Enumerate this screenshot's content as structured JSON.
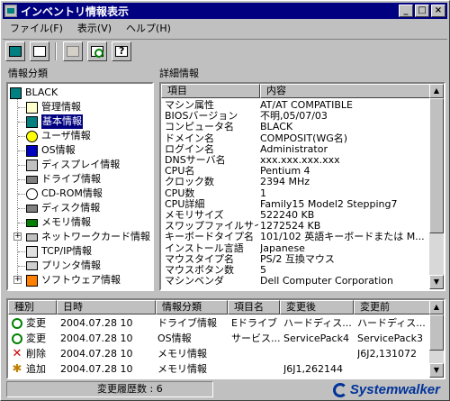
{
  "window": {
    "title": "インベントリ情報表示",
    "min_label": "_",
    "max_label": "□",
    "close_label": "×"
  },
  "menu": [
    "ファイル(F)",
    "表示(V)",
    "ヘルプ(H)"
  ],
  "left_label": "情報分類",
  "right_label": "詳細情報",
  "tree": {
    "root": "BLACK",
    "items": [
      {
        "label": "管理情報",
        "icon": "doc-icon"
      },
      {
        "label": "基本情報",
        "icon": "cpu-icon",
        "selected": true
      },
      {
        "label": "ユーザ情報",
        "icon": "user-icon"
      },
      {
        "label": "OS情報",
        "icon": "os-icon"
      },
      {
        "label": "ディスプレイ情報",
        "icon": "display-icon"
      },
      {
        "label": "ドライブ情報",
        "icon": "drive-icon"
      },
      {
        "label": "CD-ROM情報",
        "icon": "cdrom-icon"
      },
      {
        "label": "ディスク情報",
        "icon": "disk-icon"
      },
      {
        "label": "メモリ情報",
        "icon": "memory-icon"
      },
      {
        "label": "ネットワークカード情報",
        "icon": "network-icon",
        "expander": "+"
      },
      {
        "label": "TCP/IP情報",
        "icon": "tcpip-icon"
      },
      {
        "label": "プリンタ情報",
        "icon": "printer-icon"
      },
      {
        "label": "ソフトウェア情報",
        "icon": "software-icon",
        "expander": "+"
      }
    ]
  },
  "detail": {
    "headers": [
      "項目",
      "内容"
    ],
    "rows": [
      {
        "k": "マシン属性",
        "v": "AT/AT COMPATIBLE"
      },
      {
        "k": "BIOSバージョン",
        "v": "不明,05/07/03"
      },
      {
        "k": "コンピュータ名",
        "v": "BLACK"
      },
      {
        "k": "ドメイン名",
        "v": "COMPOSIT(WG名)"
      },
      {
        "k": "ログイン名",
        "v": "Administrator"
      },
      {
        "k": "DNSサーバ名",
        "v": "xxx.xxx.xxx.xxx"
      },
      {
        "k": "CPU名",
        "v": "Pentium 4"
      },
      {
        "k": "クロック数",
        "v": "2394 MHz"
      },
      {
        "k": "CPU数",
        "v": "1"
      },
      {
        "k": "CPU詳細",
        "v": "Family15 Model2 Stepping7"
      },
      {
        "k": "メモリサイズ",
        "v": "522240 KB"
      },
      {
        "k": "スワップファイルサイズ",
        "v": "1272524 KB"
      },
      {
        "k": "キーボードタイプ名",
        "v": "101/102 英語キーボードまたは M..."
      },
      {
        "k": "インストール言語",
        "v": "Japanese"
      },
      {
        "k": "マウスタイプ名",
        "v": "PS/2 互換マウス"
      },
      {
        "k": "マウスボタン数",
        "v": "5"
      },
      {
        "k": "マシンベンダ",
        "v": "Dell Computer Corporation"
      }
    ]
  },
  "history": {
    "headers": [
      "種別",
      "日時",
      "情報分類",
      "項目名",
      "変更後",
      "変更前"
    ],
    "rows": [
      {
        "type": "変更",
        "icon": "refresh-icon",
        "date": "2004.07.28  10:31:26",
        "category": "ドライブ情報",
        "item": "Eドライブ",
        "after": "ハードディス...",
        "before": "ハードディス..."
      },
      {
        "type": "変更",
        "icon": "refresh-icon",
        "date": "2004.07.28  10:31:26",
        "category": "OS情報",
        "item": "サービス...",
        "after": "ServicePack4",
        "before": "ServicePack3"
      },
      {
        "type": "削除",
        "icon": "delete-icon",
        "date": "2004.07.28  10:31:26",
        "category": "メモリ情報",
        "item": "",
        "after": "",
        "before": "J6J2,131072"
      },
      {
        "type": "追加",
        "icon": "add-icon",
        "date": "2004.07.28  10:31:26",
        "category": "メモリ情報",
        "item": "",
        "after": "J6J1,262144",
        "before": ""
      }
    ]
  },
  "status": {
    "history_count": "変更履歴数 : 6"
  },
  "logo": "Systemwalker"
}
